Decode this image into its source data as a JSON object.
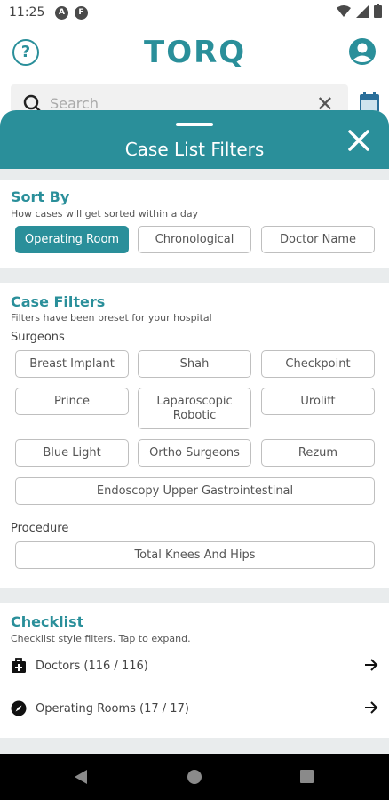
{
  "status": {
    "time": "11:25"
  },
  "header": {
    "logo": "TORQ"
  },
  "search": {
    "placeholder": "Search"
  },
  "sheet": {
    "title": "Case List Filters"
  },
  "sort": {
    "title": "Sort By",
    "subtitle": "How cases will get sorted within a day",
    "options": [
      "Operating Room",
      "Chronological",
      "Doctor Name"
    ],
    "selected": "Operating Room"
  },
  "filters": {
    "title": "Case Filters",
    "subtitle": "Filters have been preset for your hospital",
    "surgeons_label": "Surgeons",
    "surgeons": [
      "Breast Implant",
      "Shah",
      "Checkpoint",
      "Prince",
      "Laparoscopic Robotic",
      "Urolift",
      "Blue Light",
      "Ortho Surgeons",
      "Rezum",
      "Endoscopy Upper Gastrointestinal"
    ],
    "procedure_label": "Procedure",
    "procedures": [
      "Total Knees And Hips"
    ]
  },
  "checklist": {
    "title": "Checklist",
    "subtitle": "Checklist style filters. Tap to expand.",
    "items": [
      {
        "label": "Doctors (116 / 116)",
        "icon": "medical-bag-icon"
      },
      {
        "label": "Operating Rooms (17 / 17)",
        "icon": "compass-icon"
      }
    ]
  },
  "colors": {
    "accent": "#2a8f9a",
    "sheet_bg": "#e9eced"
  }
}
